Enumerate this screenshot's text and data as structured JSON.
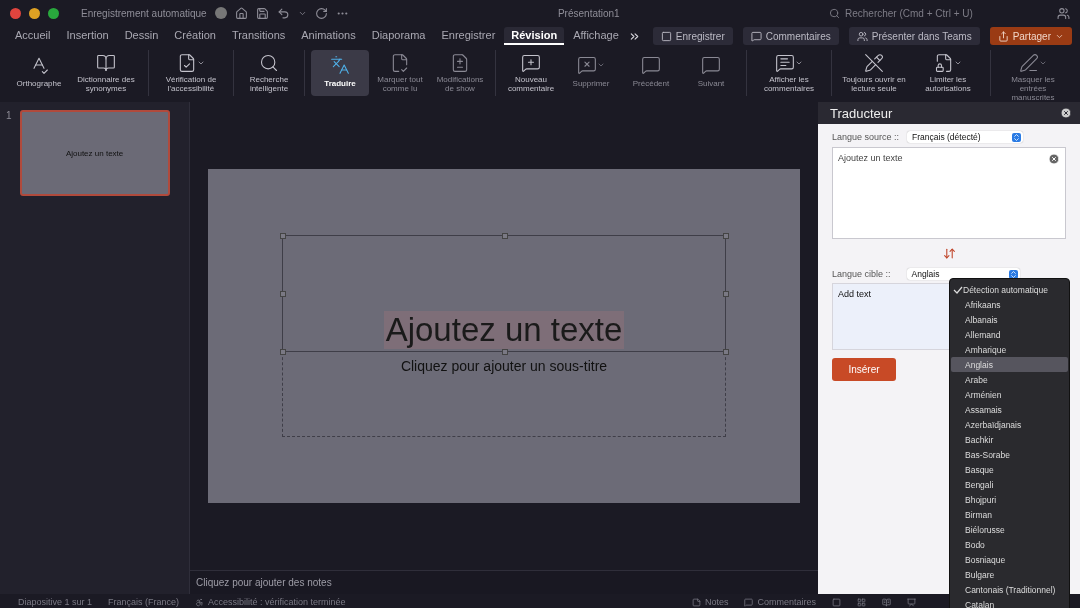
{
  "titlebar": {
    "autosave": {
      "label": "Enregistrement automatique",
      "on": false
    },
    "title": "Présentation1",
    "search": {
      "placeholder": "Rechercher (Cmd + Ctrl + U)"
    }
  },
  "tabs": [
    {
      "label": "Accueil",
      "selected": false
    },
    {
      "label": "Insertion",
      "selected": false
    },
    {
      "label": "Dessin",
      "selected": false
    },
    {
      "label": "Création",
      "selected": false
    },
    {
      "label": "Transitions",
      "selected": false
    },
    {
      "label": "Animations",
      "selected": false
    },
    {
      "label": "Diaporama",
      "selected": false
    },
    {
      "label": "Enregistrer",
      "selected": false
    },
    {
      "label": "Révision",
      "selected": true
    },
    {
      "label": "Affichage",
      "selected": false
    }
  ],
  "header_buttons": [
    {
      "label": "Enregistrer",
      "kind": "record"
    },
    {
      "label": "Commentaires",
      "kind": "comments"
    },
    {
      "label": "Présenter dans Teams",
      "kind": "teams"
    },
    {
      "label": "Partager",
      "kind": "share"
    }
  ],
  "ribbon": [
    {
      "items": [
        {
          "label": "Orthographe",
          "disabled": false,
          "selected": false,
          "menu": false
        },
        {
          "label": "Dictionnaire des synonymes",
          "disabled": false,
          "selected": false,
          "menu": false
        }
      ]
    },
    {
      "items": [
        {
          "label": "Vérification de l'accessibilité",
          "disabled": false,
          "selected": false,
          "menu": true
        }
      ]
    },
    {
      "items": [
        {
          "label": "Recherche intelligente",
          "disabled": false,
          "selected": false,
          "menu": false
        }
      ]
    },
    {
      "items": [
        {
          "label": "Traduire",
          "disabled": false,
          "selected": true,
          "menu": false
        },
        {
          "label": "Marquer tout comme lu",
          "disabled": true,
          "selected": false,
          "menu": false
        },
        {
          "label": "Modifications de show",
          "disabled": true,
          "selected": false,
          "menu": false
        }
      ]
    },
    {
      "items": [
        {
          "label": "Nouveau commentaire",
          "disabled": false,
          "selected": false,
          "menu": false
        },
        {
          "label": "Supprimer",
          "disabled": true,
          "selected": false,
          "menu": true
        },
        {
          "label": "Précédent",
          "disabled": true,
          "selected": false,
          "menu": false
        },
        {
          "label": "Suivant",
          "disabled": true,
          "selected": false,
          "menu": false
        }
      ]
    },
    {
      "items": [
        {
          "label": "Afficher les commentaires",
          "disabled": false,
          "selected": false,
          "menu": true
        }
      ]
    },
    {
      "items": [
        {
          "label": "Toujours ouvrir en lecture seule",
          "disabled": false,
          "selected": false,
          "menu": false
        },
        {
          "label": "Limiter les autorisations",
          "disabled": false,
          "selected": false,
          "menu": true
        }
      ]
    },
    {
      "items": [
        {
          "label": "Masquer les entrées manuscrites",
          "disabled": true,
          "selected": false,
          "menu": true
        }
      ]
    }
  ],
  "slides": [
    {
      "number": "1",
      "text": "Ajoutez un texte",
      "selected": true
    }
  ],
  "slide": {
    "title": "Ajoutez un texte",
    "subtitle": "Cliquez pour ajouter un sous-titre"
  },
  "notes": {
    "placeholder": "Cliquez pour ajouter des notes"
  },
  "translator": {
    "title": "Traducteur",
    "source_label": "Langue source ::",
    "source_language": "Français (détecté)",
    "source_text": "Ajoutez un texte",
    "target_label": "Langue cible ::",
    "target_language": "Anglais",
    "target_text": "Add text",
    "insert_button": "Insérer",
    "language_menu": [
      {
        "label": "Détection automatique",
        "checked": true,
        "selected": false
      },
      {
        "label": "Afrikaans",
        "checked": false,
        "selected": false
      },
      {
        "label": "Albanais",
        "checked": false,
        "selected": false
      },
      {
        "label": "Allemand",
        "checked": false,
        "selected": false
      },
      {
        "label": "Amharique",
        "checked": false,
        "selected": false
      },
      {
        "label": "Anglais",
        "checked": false,
        "selected": true
      },
      {
        "label": "Arabe",
        "checked": false,
        "selected": false
      },
      {
        "label": "Arménien",
        "checked": false,
        "selected": false
      },
      {
        "label": "Assamais",
        "checked": false,
        "selected": false
      },
      {
        "label": "Azerbaïdjanais",
        "checked": false,
        "selected": false
      },
      {
        "label": "Bachkir",
        "checked": false,
        "selected": false
      },
      {
        "label": "Bas-Sorabe",
        "checked": false,
        "selected": false
      },
      {
        "label": "Basque",
        "checked": false,
        "selected": false
      },
      {
        "label": "Bengali",
        "checked": false,
        "selected": false
      },
      {
        "label": "Bhojpuri",
        "checked": false,
        "selected": false
      },
      {
        "label": "Birman",
        "checked": false,
        "selected": false
      },
      {
        "label": "Biélorusse",
        "checked": false,
        "selected": false
      },
      {
        "label": "Bodo",
        "checked": false,
        "selected": false
      },
      {
        "label": "Bosniaque",
        "checked": false,
        "selected": false
      },
      {
        "label": "Bulgare",
        "checked": false,
        "selected": false
      },
      {
        "label": "Cantonais (Traditionnel)",
        "checked": false,
        "selected": false
      },
      {
        "label": "Catalan",
        "checked": false,
        "selected": false
      }
    ]
  },
  "status_bar": {
    "slide_count": "Diapositive 1 sur 1",
    "language": "Français (France)",
    "accessibility": "Accessibilité : vérification terminée",
    "notes": "Notes",
    "comments": "Commentaires"
  }
}
